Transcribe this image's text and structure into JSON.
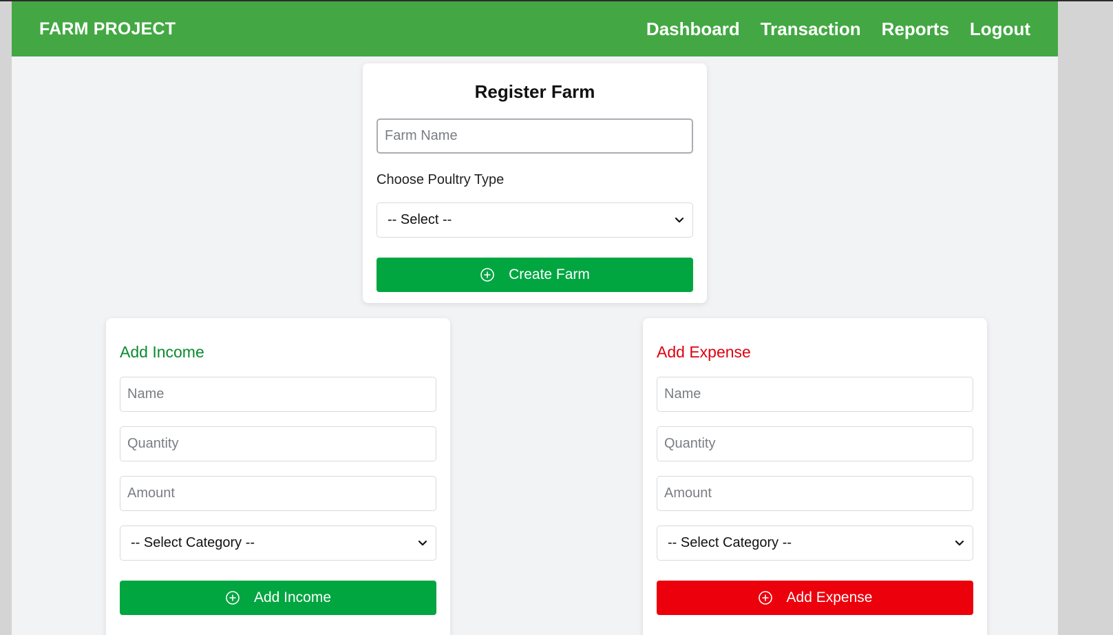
{
  "navbar": {
    "brand": "FARM PROJECT",
    "links": [
      "Dashboard",
      "Transaction",
      "Reports",
      "Logout"
    ]
  },
  "register_farm": {
    "title": "Register Farm",
    "farm_name_placeholder": "Farm Name",
    "poultry_label": "Choose Poultry Type",
    "poultry_select_value": "-- Select --",
    "create_button": "Create Farm"
  },
  "income": {
    "title": "Add Income",
    "name_placeholder": "Name",
    "quantity_placeholder": "Quantity",
    "amount_placeholder": "Amount",
    "category_value": "-- Select Category --",
    "button": "Add Income"
  },
  "expense": {
    "title": "Add Expense",
    "name_placeholder": "Name",
    "quantity_placeholder": "Quantity",
    "amount_placeholder": "Amount",
    "category_value": "-- Select Category --",
    "button": "Add Expense"
  },
  "icons": {
    "add": "plus-circle-icon",
    "dropdown": "chevron-down-icon"
  },
  "colors": {
    "navbar": "#43a843",
    "primary_button": "#01a641",
    "danger_button": "#eb000c",
    "income_title": "#0a8a2f",
    "expense_title": "#e00010"
  }
}
